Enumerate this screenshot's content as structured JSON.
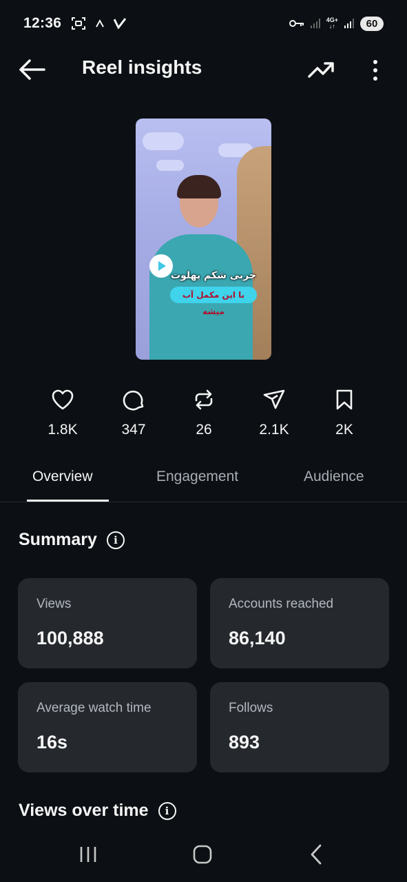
{
  "status_bar": {
    "time": "12:36",
    "battery": "60",
    "network_type": "4G+",
    "icons": [
      "screenshot-icon",
      "arrow-up-icon",
      "app-v-icon",
      "vpn-key-icon",
      "signal-icon",
      "signal-icon"
    ]
  },
  "header": {
    "title": "Reel insights"
  },
  "thumbnail": {
    "caption_line1": "چربی شکم پهلوت",
    "caption_line2": "با این مکمل آب میشه"
  },
  "stats": [
    {
      "icon": "heart-icon",
      "value": "1.8K"
    },
    {
      "icon": "comment-icon",
      "value": "347"
    },
    {
      "icon": "repost-icon",
      "value": "26"
    },
    {
      "icon": "share-icon",
      "value": "2.1K"
    },
    {
      "icon": "bookmark-icon",
      "value": "2K"
    }
  ],
  "tabs": {
    "overview": "Overview",
    "engagement": "Engagement",
    "audience": "Audience",
    "active": "overview"
  },
  "summary": {
    "title": "Summary",
    "cards": [
      {
        "label": "Views",
        "value": "100,888"
      },
      {
        "label": "Accounts reached",
        "value": "86,140"
      },
      {
        "label": "Average watch time",
        "value": "16s"
      },
      {
        "label": "Follows",
        "value": "893"
      }
    ]
  },
  "views_over_time": {
    "title": "Views over time"
  },
  "colors": {
    "background": "#0c1014",
    "card": "#25292e",
    "muted_text": "#a8adb5"
  }
}
